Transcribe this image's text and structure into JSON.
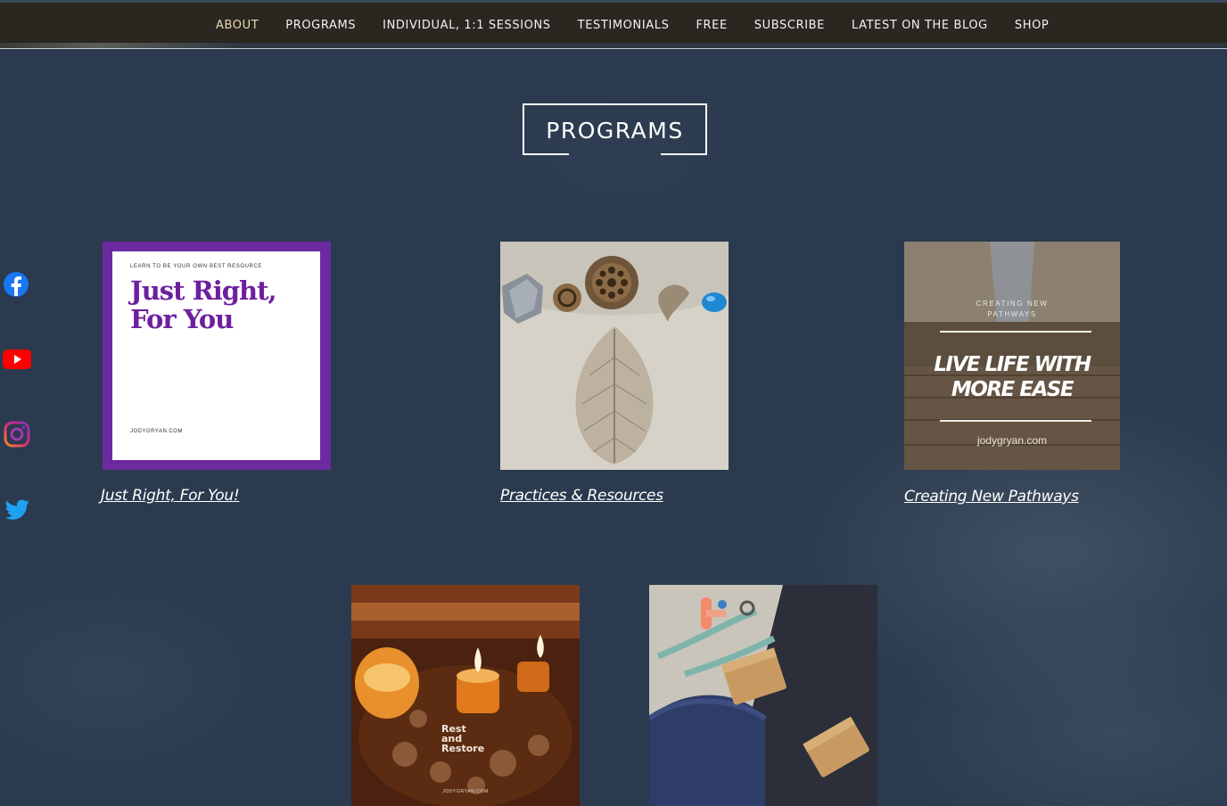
{
  "nav": {
    "items": [
      {
        "label": "ABOUT",
        "active": true
      },
      {
        "label": "PROGRAMS"
      },
      {
        "label": "INDIVIDUAL, 1:1 SESSIONS"
      },
      {
        "label": "TESTIMONIALS"
      },
      {
        "label": "FREE"
      },
      {
        "label": "SUBSCRIBE"
      },
      {
        "label": "LATEST ON THE BLOG"
      },
      {
        "label": "SHOP"
      }
    ]
  },
  "section": {
    "title": "PROGRAMS"
  },
  "social": [
    {
      "icon": "facebook-icon",
      "color": "#1877f2"
    },
    {
      "icon": "youtube-icon",
      "color": "#ff0000"
    },
    {
      "icon": "instagram-icon",
      "color": "#8a3ab9"
    },
    {
      "icon": "twitter-icon",
      "color": "#1da1f2"
    }
  ],
  "programs": [
    {
      "caption": "Just Right, For You!",
      "image": {
        "tagline": "LEARN TO BE YOUR OWN BEST RESOURCE",
        "title_line1": "Just Right,",
        "title_line2": "For You",
        "site": "JODYGRYAN.COM"
      }
    },
    {
      "caption": "Practices & Resources"
    },
    {
      "caption": "Creating New Pathways",
      "image": {
        "small_line1": "CREATING NEW",
        "small_line2": "PATHWAYS",
        "big_line1": "LIVE LIFE WITH",
        "big_line2": "MORE EASE",
        "site": "jodygryan.com"
      }
    },
    {
      "caption": "",
      "image": {
        "line1": "Rest",
        "line2": "and",
        "line3": "Restore",
        "site": "JODYGRYAN.COM"
      }
    },
    {
      "caption": ""
    }
  ],
  "colors": {
    "background": "#2b3a4e",
    "navbar": "#2a2620",
    "accent_purple": "#6d2aa0"
  }
}
